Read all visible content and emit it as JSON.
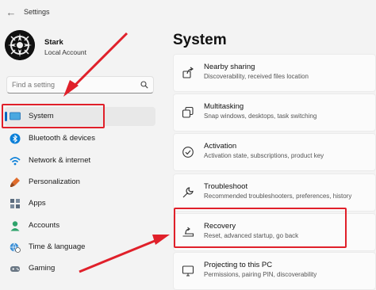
{
  "window": {
    "title": "Settings"
  },
  "profile": {
    "name": "Stark",
    "account_type": "Local Account"
  },
  "search": {
    "placeholder": "Find a setting"
  },
  "sidebar": {
    "items": [
      {
        "label": "System",
        "icon": "monitor-icon",
        "selected": true
      },
      {
        "label": "Bluetooth & devices",
        "icon": "bluetooth-icon"
      },
      {
        "label": "Network & internet",
        "icon": "wifi-icon"
      },
      {
        "label": "Personalization",
        "icon": "brush-icon"
      },
      {
        "label": "Apps",
        "icon": "apps-icon"
      },
      {
        "label": "Accounts",
        "icon": "person-icon"
      },
      {
        "label": "Time & language",
        "icon": "globe-clock-icon"
      },
      {
        "label": "Gaming",
        "icon": "gamepad-icon"
      }
    ]
  },
  "main": {
    "title": "System",
    "cards": [
      {
        "title": "Nearby sharing",
        "subtitle": "Discoverability, received files location",
        "icon": "share-icon"
      },
      {
        "title": "Multitasking",
        "subtitle": "Snap windows, desktops, task switching",
        "icon": "multitask-icon"
      },
      {
        "title": "Activation",
        "subtitle": "Activation state, subscriptions, product key",
        "icon": "check-circle-icon"
      },
      {
        "title": "Troubleshoot",
        "subtitle": "Recommended troubleshooters, preferences, history",
        "icon": "wrench-icon"
      },
      {
        "title": "Recovery",
        "subtitle": "Reset, advanced startup, go back",
        "icon": "recovery-icon"
      },
      {
        "title": "Projecting to this PC",
        "subtitle": "Permissions, pairing PIN, discoverability",
        "icon": "projector-icon"
      }
    ]
  },
  "annotations": {
    "highlight_color": "#e0202a"
  }
}
